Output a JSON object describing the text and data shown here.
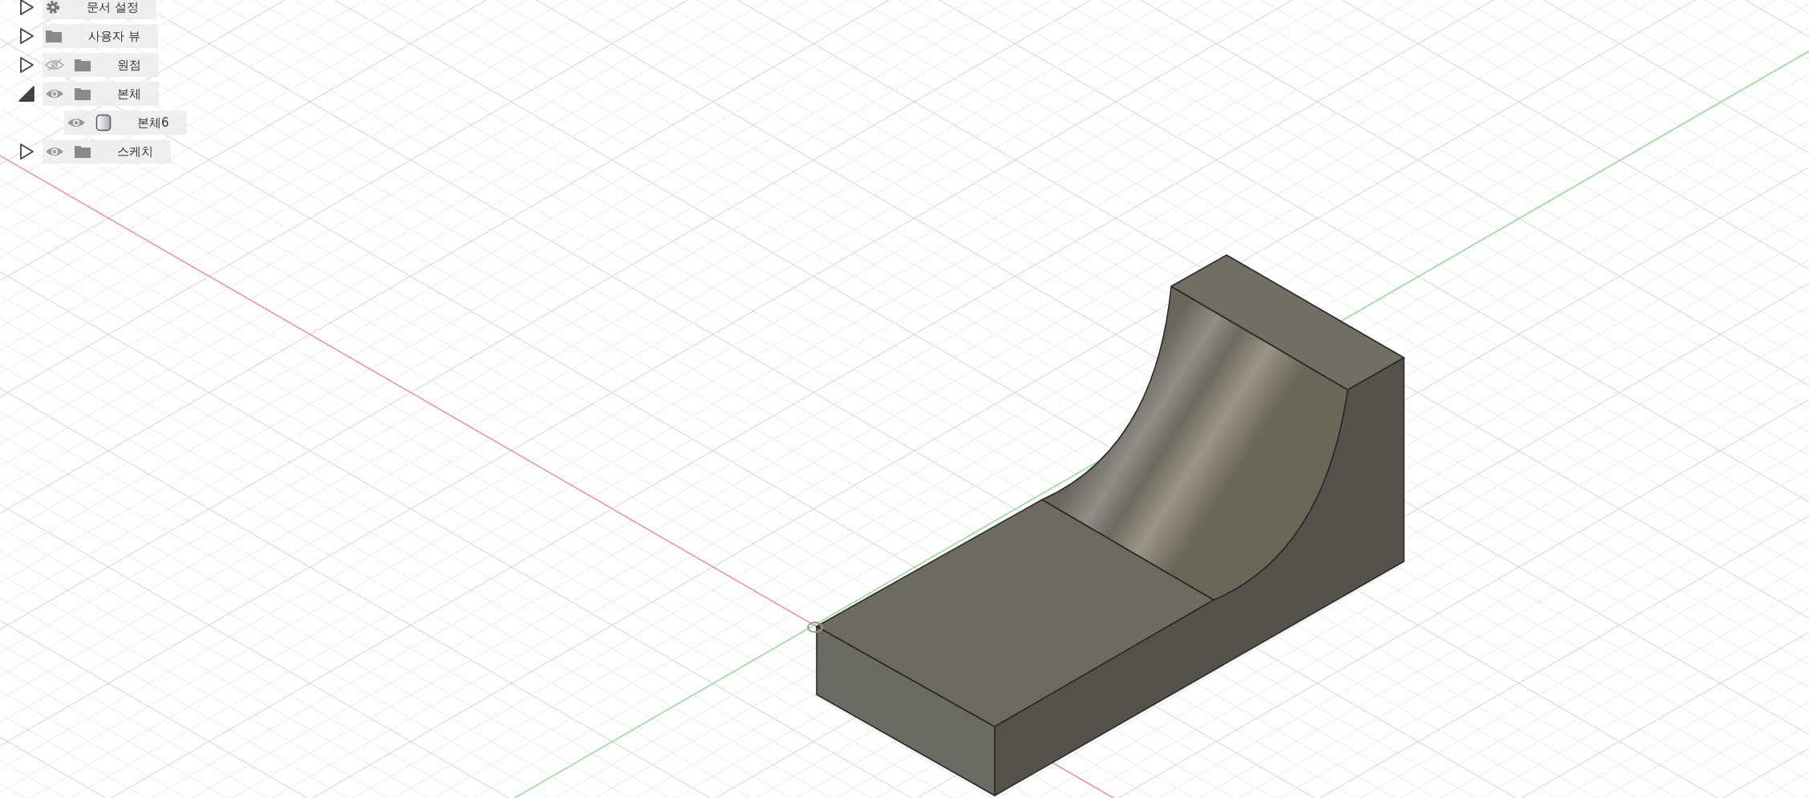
{
  "browser": {
    "items": [
      {
        "kind": "settings",
        "label": "문서 설정",
        "expanded": false
      },
      {
        "kind": "folder",
        "label": "사용자 뷰",
        "expanded": false
      },
      {
        "kind": "folder",
        "label": "원점",
        "expanded": false,
        "visible": false
      },
      {
        "kind": "folder",
        "label": "본체",
        "expanded": true,
        "visible": true,
        "children": [
          {
            "kind": "body",
            "label": "본체6",
            "visible": true
          }
        ]
      },
      {
        "kind": "folder",
        "label": "스케치",
        "expanded": false,
        "visible": true
      }
    ]
  }
}
